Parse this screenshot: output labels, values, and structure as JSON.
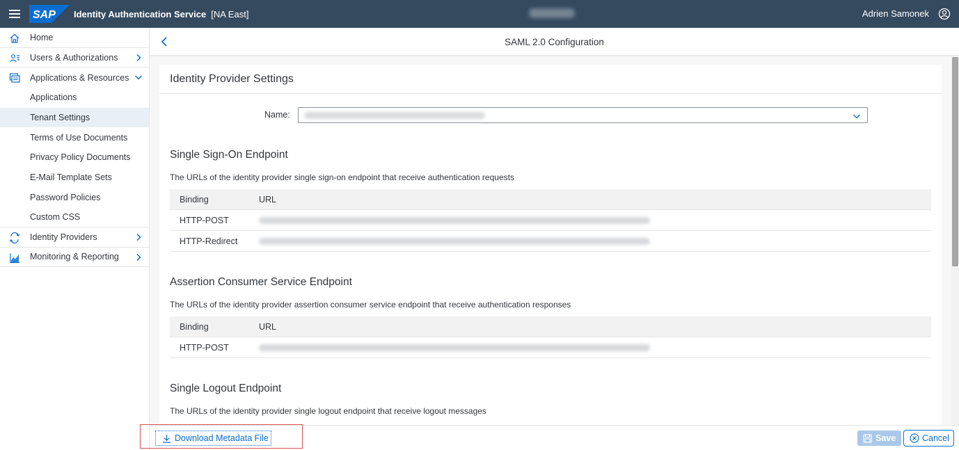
{
  "header": {
    "menu_icon": "hamburger-menu-icon",
    "logo": "SAP",
    "product_title": "Identity Authentication Service",
    "region": "[NA East]",
    "user_name": "Adrien Samonek",
    "user_icon": "user-circle-icon",
    "colors": {
      "shell": "#354a5f",
      "logo": "#0a6ed1"
    }
  },
  "sidebar": {
    "items": [
      {
        "label": "Home",
        "icon": "home-icon",
        "level": "top",
        "chevron": "none"
      },
      {
        "label": "Users & Authorizations",
        "icon": "users-icon",
        "level": "top",
        "chevron": "right"
      },
      {
        "label": "Applications & Resources",
        "icon": "applications-icon",
        "level": "top",
        "chevron": "down"
      },
      {
        "label": "Applications",
        "level": "sub"
      },
      {
        "label": "Tenant Settings",
        "level": "sub",
        "selected": true
      },
      {
        "label": "Terms of Use Documents",
        "level": "sub"
      },
      {
        "label": "Privacy Policy Documents",
        "level": "sub"
      },
      {
        "label": "E-Mail Template Sets",
        "level": "sub"
      },
      {
        "label": "Password Policies",
        "level": "sub"
      },
      {
        "label": "Custom CSS",
        "level": "sub"
      },
      {
        "label": "Identity Providers",
        "icon": "identity-providers-icon",
        "level": "top",
        "chevron": "right"
      },
      {
        "label": "Monitoring & Reporting",
        "icon": "monitoring-icon",
        "level": "top",
        "chevron": "right"
      }
    ]
  },
  "page": {
    "back_icon": "chevron-left-icon",
    "title": "SAML 2.0 Configuration"
  },
  "panel": {
    "title": "Identity Provider Settings",
    "name_label": "Name:",
    "name_value": "",
    "name_dropdown_icon": "chevron-down-icon"
  },
  "sections": {
    "sso": {
      "title": "Single Sign-On Endpoint",
      "description": "The URLs of the identity provider single sign-on endpoint that receive authentication requests",
      "columns": [
        "Binding",
        "URL"
      ],
      "rows": [
        {
          "binding": "HTTP-POST",
          "url": ""
        },
        {
          "binding": "HTTP-Redirect",
          "url": ""
        }
      ]
    },
    "acs": {
      "title": "Assertion Consumer Service Endpoint",
      "description": "The URLs of the identity provider assertion consumer service endpoint that receive authentication responses",
      "columns": [
        "Binding",
        "URL"
      ],
      "rows": [
        {
          "binding": "HTTP-POST",
          "url": ""
        }
      ]
    },
    "slo": {
      "title": "Single Logout Endpoint",
      "description": "The URLs of the identity provider single logout endpoint that receive logout messages"
    }
  },
  "footer": {
    "download_label": "Download Metadata File",
    "download_icon": "download-icon",
    "save_label": "Save",
    "save_icon": "save-icon",
    "cancel_label": "Cancel",
    "cancel_icon": "cancel-circle-icon"
  }
}
